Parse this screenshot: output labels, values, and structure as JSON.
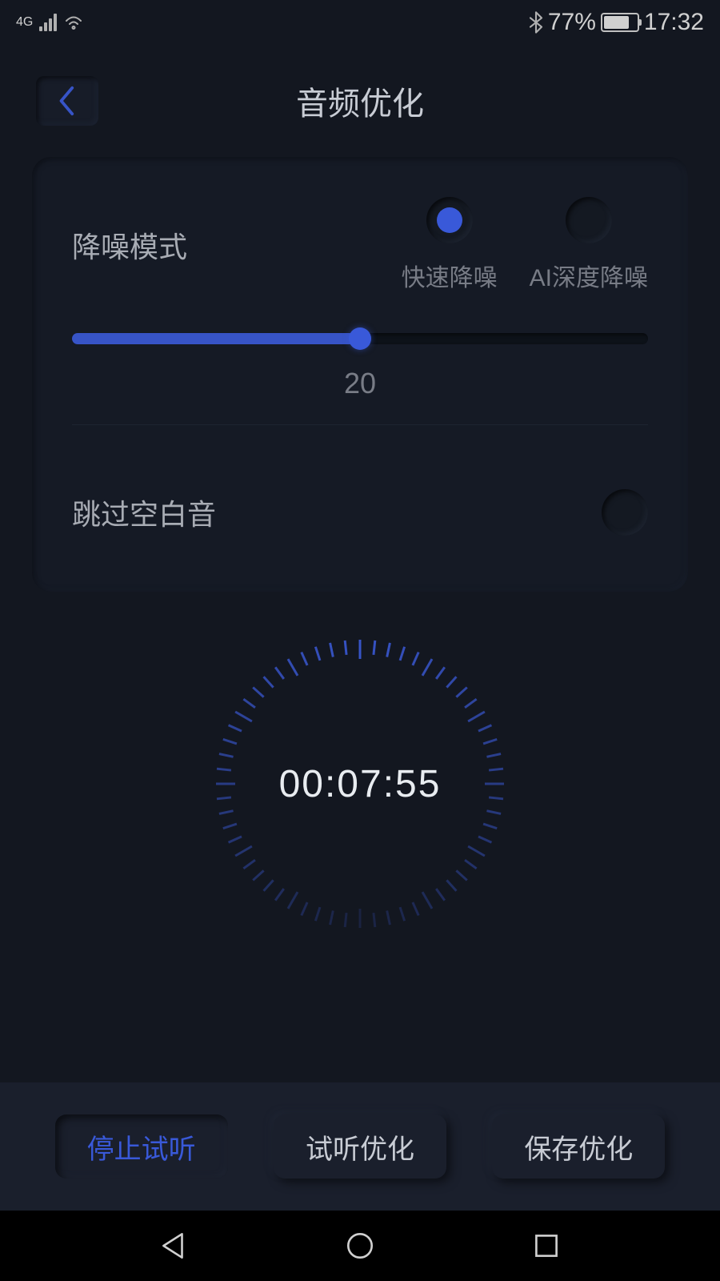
{
  "status_bar": {
    "network": "4G",
    "bluetooth_icon": "bluetooth-icon",
    "battery_percent": "77%",
    "time": "17:32"
  },
  "header": {
    "title": "音频优化"
  },
  "settings": {
    "noise_mode": {
      "label": "降噪模式",
      "options": [
        {
          "label": "快速降噪",
          "selected": true
        },
        {
          "label": "AI深度降噪",
          "selected": false
        }
      ]
    },
    "slider": {
      "value": "20",
      "percent": 50
    },
    "skip_silence": {
      "label": "跳过空白音",
      "checked": false
    }
  },
  "timer": {
    "value": "00:07:55"
  },
  "actions": {
    "stop": "停止试听",
    "preview": "试听优化",
    "save": "保存优化"
  }
}
